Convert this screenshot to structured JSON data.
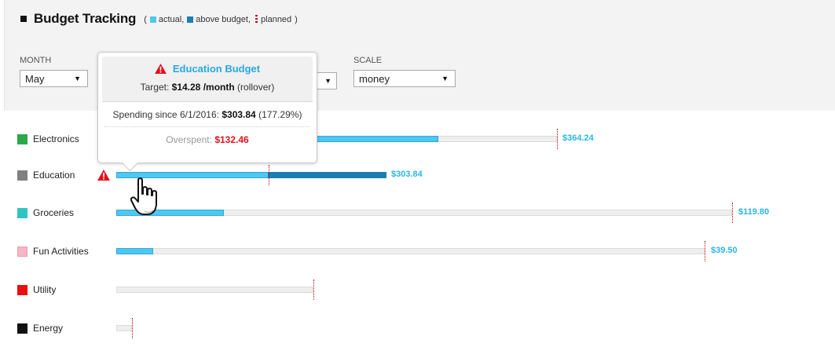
{
  "header": {
    "title": "Budget Tracking",
    "legend": {
      "open": "(",
      "actual": "actual,",
      "above": "above budget,",
      "planned": "planned",
      "close": ")"
    }
  },
  "filters": {
    "month": {
      "label": "MONTH",
      "value": "May"
    },
    "scale": {
      "label": "SCALE",
      "value": "money"
    }
  },
  "categories": [
    {
      "name": "Electronics",
      "color": "#2aa84a",
      "amount": "$364.24",
      "actual_pct_of_planned": 0.73
    },
    {
      "name": "Education",
      "color": "#808080",
      "amount": "$303.84",
      "actual_pct_of_planned": 1.7729
    },
    {
      "name": "Groceries",
      "color": "#2ec4c4",
      "amount": "$119.80",
      "actual_pct_of_planned": 0.17
    },
    {
      "name": "Fun Activities",
      "color": "#f7b6c8",
      "amount": "$39.50",
      "actual_pct_of_planned": 0.06
    },
    {
      "name": "Utility",
      "color": "#e81010",
      "amount": "",
      "actual_pct_of_planned": 0
    },
    {
      "name": "Energy",
      "color": "#111111",
      "amount": "",
      "actual_pct_of_planned": 0
    }
  ],
  "tooltip": {
    "title": "Education Budget",
    "target_prefix": "Target: ",
    "target_value": "$14.28 /month",
    "target_suffix": " (rollover)",
    "spending_prefix": "Spending since 6/1/2016:",
    "spending_value": "$303.84",
    "spending_pct": "(177.29%)",
    "overspent_label": "Overspent:",
    "overspent_value": "$132.46"
  },
  "colors": {
    "actual": "#4ec8f0",
    "above_budget": "#1a7fb0",
    "planned": "#c00000",
    "amount_text": "#29b6e8",
    "warning": "#e0111b"
  },
  "icons": [
    "warning-icon",
    "hand-cursor-icon",
    "dropdown-arrow-icon"
  ]
}
